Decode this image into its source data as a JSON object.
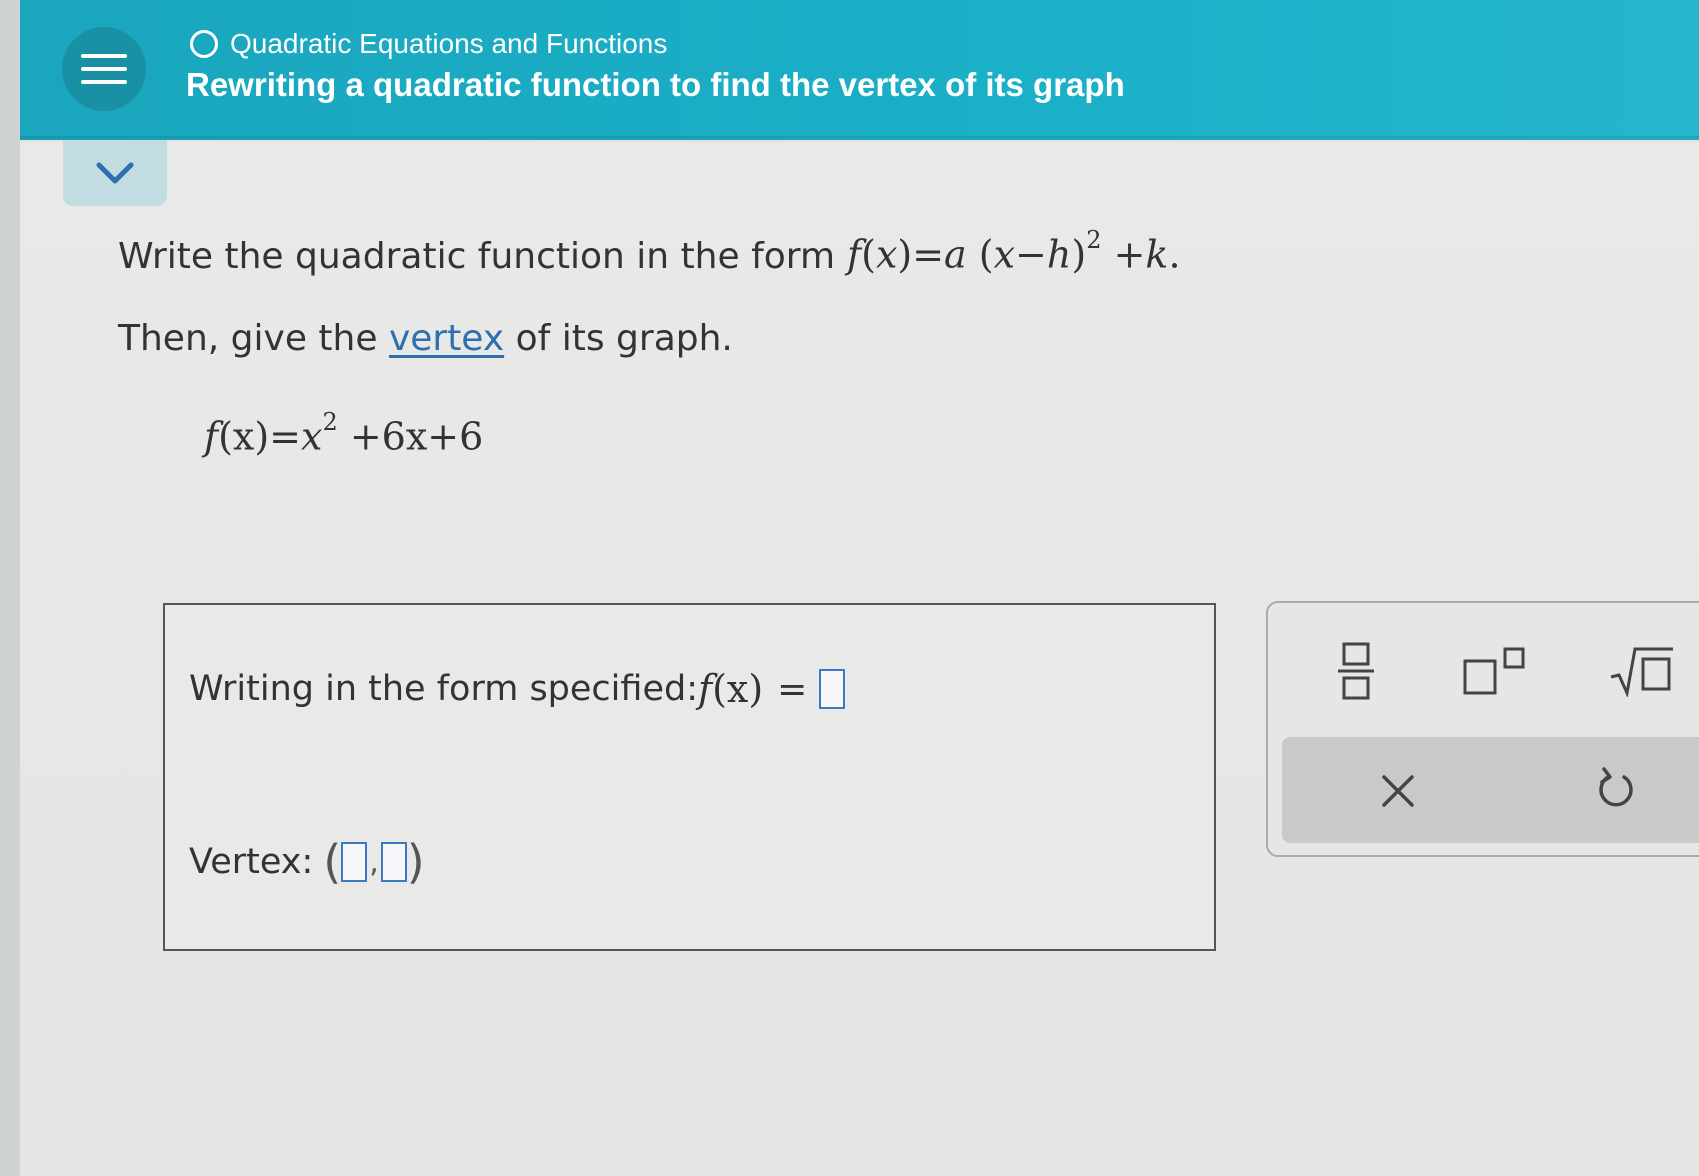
{
  "header": {
    "topic": "Quadratic Equations and Functions",
    "title": "Rewriting a quadratic function to find the vertex of its graph"
  },
  "problem": {
    "instruction_prefix": "Write the quadratic function in the form",
    "form_expression": {
      "f": "f",
      "lhs_open": "(",
      "x": "x",
      "lhs_close": ")=",
      "a": "a",
      "open": " (",
      "x2": "x",
      "minus": "−",
      "h": "h",
      "close": ")",
      "exp": "2",
      "plus": " +",
      "k": "k",
      "period": "."
    },
    "instruction2_prefix": "Then, give the ",
    "instruction2_link": "vertex",
    "instruction2_suffix": " of its graph.",
    "given": {
      "f": "f",
      "arg": "(x)",
      "equals": "=",
      "x": "x",
      "exp": "2",
      "rest": " +6x+6"
    }
  },
  "answer": {
    "form_label": "Writing in the form specified: ",
    "f": "f",
    "arg": "(x)",
    "equals": "=",
    "vertex_label": "Vertex: ",
    "open_paren": "(",
    "comma": ",",
    "close_paren": ")"
  },
  "toolbar": {
    "tools": [
      "fraction-icon",
      "exponent-icon",
      "square-root-icon",
      "clear-icon",
      "undo-icon"
    ]
  },
  "colors": {
    "header": "#1aa6bd",
    "link": "#2f6fb0",
    "input_border": "#3a79c4"
  }
}
